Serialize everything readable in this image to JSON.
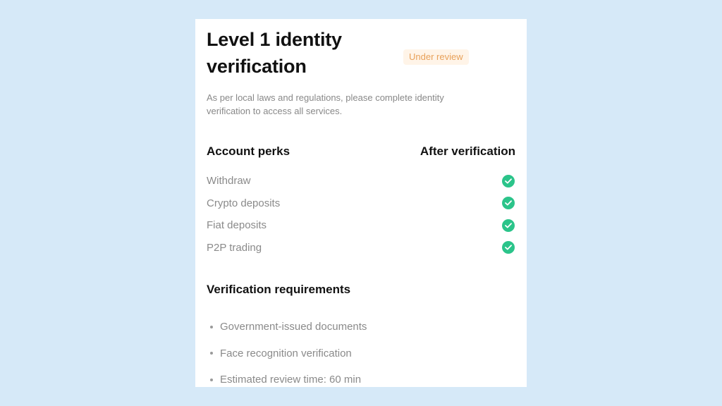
{
  "header": {
    "title": "Level 1 identity verification",
    "status_badge": "Under review",
    "description": "As per local laws and regulations, please complete identity verification to access all services."
  },
  "perks": {
    "column_left": "Account perks",
    "column_right": "After verification",
    "items": [
      {
        "label": "Withdraw",
        "status_icon": "check-circle-icon"
      },
      {
        "label": "Crypto deposits",
        "status_icon": "check-circle-icon"
      },
      {
        "label": "Fiat deposits",
        "status_icon": "check-circle-icon"
      },
      {
        "label": "P2P trading",
        "status_icon": "check-circle-icon"
      }
    ]
  },
  "requirements": {
    "title": "Verification requirements",
    "items": [
      "Government-issued documents",
      "Face recognition verification",
      "Estimated review time: 60 min"
    ]
  },
  "colors": {
    "background": "#d6e9f8",
    "card": "#ffffff",
    "check": "#2bc48a",
    "badge_text": "#e8a15a",
    "badge_bg": "#fff4e8"
  }
}
